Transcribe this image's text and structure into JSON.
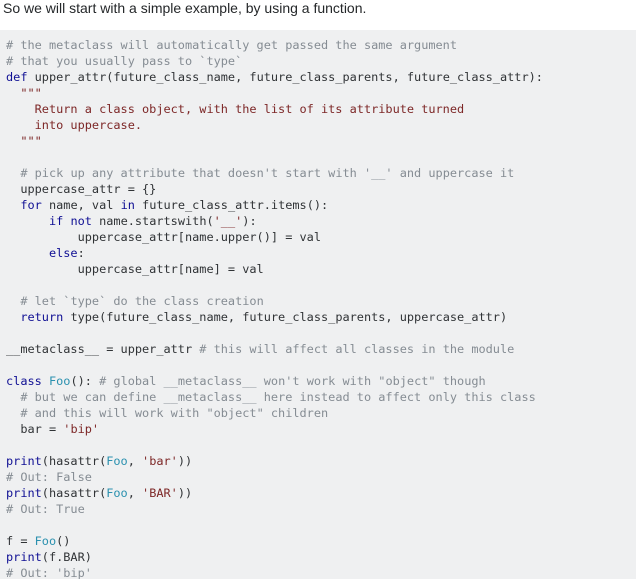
{
  "intro_text": "So we will start with a simple example, by using a function.",
  "colors": {
    "code_background": "#eff0f1",
    "comment": "#858c93",
    "keyword": "#101094",
    "string": "#7d2727",
    "type": "#2b91af",
    "plain": "#303336"
  },
  "code_lines": [
    [
      {
        "t": "cmt",
        "v": "# the metaclass will automatically get passed the same argument"
      }
    ],
    [
      {
        "t": "cmt",
        "v": "# that you usually pass to `type`"
      }
    ],
    [
      {
        "t": "kw",
        "v": "def"
      },
      {
        "t": "pln",
        "v": " upper_attr(future_class_name, future_class_parents, future_class_attr):"
      }
    ],
    [
      {
        "t": "str",
        "v": "  \"\"\""
      }
    ],
    [
      {
        "t": "str",
        "v": "    Return a class object, with the list of its attribute turned"
      }
    ],
    [
      {
        "t": "str",
        "v": "    into uppercase."
      }
    ],
    [
      {
        "t": "str",
        "v": "  \"\"\""
      }
    ],
    [],
    [
      {
        "t": "pln",
        "v": "  "
      },
      {
        "t": "cmt",
        "v": "# pick up any attribute that doesn't start with '__' and uppercase it"
      }
    ],
    [
      {
        "t": "pln",
        "v": "  uppercase_attr = {}"
      }
    ],
    [
      {
        "t": "pln",
        "v": "  "
      },
      {
        "t": "kw",
        "v": "for"
      },
      {
        "t": "pln",
        "v": " name, val "
      },
      {
        "t": "kw",
        "v": "in"
      },
      {
        "t": "pln",
        "v": " future_class_attr.items():"
      }
    ],
    [
      {
        "t": "pln",
        "v": "      "
      },
      {
        "t": "kw",
        "v": "if"
      },
      {
        "t": "pln",
        "v": " "
      },
      {
        "t": "kw",
        "v": "not"
      },
      {
        "t": "pln",
        "v": " name.startswith("
      },
      {
        "t": "str",
        "v": "'__'"
      },
      {
        "t": "pln",
        "v": "):"
      }
    ],
    [
      {
        "t": "pln",
        "v": "          uppercase_attr[name.upper()] = val"
      }
    ],
    [
      {
        "t": "pln",
        "v": "      "
      },
      {
        "t": "kw",
        "v": "else"
      },
      {
        "t": "pln",
        "v": ":"
      }
    ],
    [
      {
        "t": "pln",
        "v": "          uppercase_attr[name] = val"
      }
    ],
    [],
    [
      {
        "t": "pln",
        "v": "  "
      },
      {
        "t": "cmt",
        "v": "# let `type` do the class creation"
      }
    ],
    [
      {
        "t": "pln",
        "v": "  "
      },
      {
        "t": "kw",
        "v": "return"
      },
      {
        "t": "pln",
        "v": " type(future_class_name, future_class_parents, uppercase_attr)"
      }
    ],
    [],
    [
      {
        "t": "pln",
        "v": "__metaclass__ = upper_attr "
      },
      {
        "t": "cmt",
        "v": "# this will affect all classes in the module"
      }
    ],
    [],
    [
      {
        "t": "kw",
        "v": "class"
      },
      {
        "t": "pln",
        "v": " "
      },
      {
        "t": "typ",
        "v": "Foo"
      },
      {
        "t": "pln",
        "v": "(): "
      },
      {
        "t": "cmt",
        "v": "# global __metaclass__ won't work with \"object\" though"
      }
    ],
    [
      {
        "t": "pln",
        "v": "  "
      },
      {
        "t": "cmt",
        "v": "# but we can define __metaclass__ here instead to affect only this class"
      }
    ],
    [
      {
        "t": "pln",
        "v": "  "
      },
      {
        "t": "cmt",
        "v": "# and this will work with \"object\" children"
      }
    ],
    [
      {
        "t": "pln",
        "v": "  bar = "
      },
      {
        "t": "str",
        "v": "'bip'"
      }
    ],
    [],
    [
      {
        "t": "kw",
        "v": "print"
      },
      {
        "t": "pln",
        "v": "(hasattr("
      },
      {
        "t": "typ",
        "v": "Foo"
      },
      {
        "t": "pln",
        "v": ", "
      },
      {
        "t": "str",
        "v": "'bar'"
      },
      {
        "t": "pln",
        "v": "))"
      }
    ],
    [
      {
        "t": "cmt",
        "v": "# Out: False"
      }
    ],
    [
      {
        "t": "kw",
        "v": "print"
      },
      {
        "t": "pln",
        "v": "(hasattr("
      },
      {
        "t": "typ",
        "v": "Foo"
      },
      {
        "t": "pln",
        "v": ", "
      },
      {
        "t": "str",
        "v": "'BAR'"
      },
      {
        "t": "pln",
        "v": "))"
      }
    ],
    [
      {
        "t": "cmt",
        "v": "# Out: True"
      }
    ],
    [],
    [
      {
        "t": "pln",
        "v": "f = "
      },
      {
        "t": "typ",
        "v": "Foo"
      },
      {
        "t": "pln",
        "v": "()"
      }
    ],
    [
      {
        "t": "kw",
        "v": "print"
      },
      {
        "t": "pln",
        "v": "(f.BAR)"
      }
    ],
    [
      {
        "t": "cmt",
        "v": "# Out: 'bip'"
      }
    ]
  ]
}
